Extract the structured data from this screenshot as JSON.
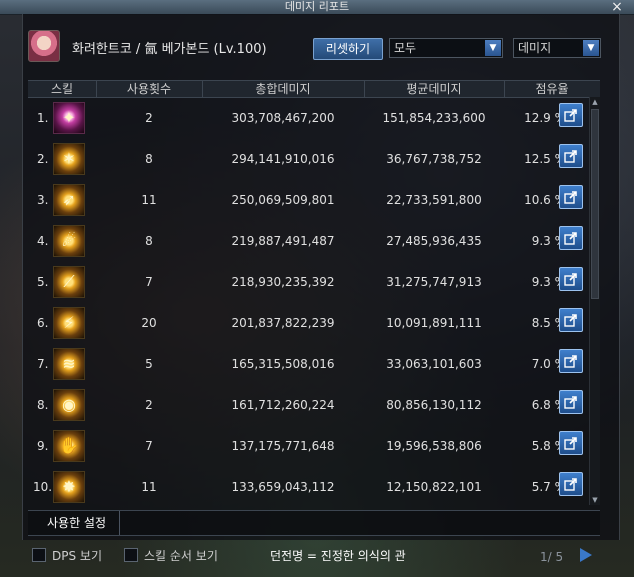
{
  "window": {
    "title": "데미지 리포트"
  },
  "header": {
    "character": "화려한트코 / 氤 베가본드 (Lv.100)",
    "reset_label": "리셋하기",
    "mode_select": "모두",
    "type_select": "데미지"
  },
  "table": {
    "columns": [
      "스킬",
      "사용횟수",
      "총합데미지",
      "평균데미지",
      "점유율"
    ],
    "rows": [
      {
        "rank": "1.",
        "count": "2",
        "total": "303,708,467,200",
        "avg": "151,854,233,600",
        "share": "12.9 %"
      },
      {
        "rank": "2.",
        "count": "8",
        "total": "294,141,910,016",
        "avg": "36,767,738,752",
        "share": "12.5 %"
      },
      {
        "rank": "3.",
        "count": "11",
        "total": "250,069,509,801",
        "avg": "22,733,591,800",
        "share": "10.6 %"
      },
      {
        "rank": "4.",
        "count": "8",
        "total": "219,887,491,487",
        "avg": "27,485,936,435",
        "share": "9.3 %"
      },
      {
        "rank": "5.",
        "count": "7",
        "total": "218,930,235,392",
        "avg": "31,275,747,913",
        "share": "9.3 %"
      },
      {
        "rank": "6.",
        "count": "20",
        "total": "201,837,822,239",
        "avg": "10,091,891,111",
        "share": "8.5 %"
      },
      {
        "rank": "7.",
        "count": "5",
        "total": "165,315,508,016",
        "avg": "33,063,101,603",
        "share": "7.0 %"
      },
      {
        "rank": "8.",
        "count": "2",
        "total": "161,712,260,224",
        "avg": "80,856,130,112",
        "share": "6.8 %"
      },
      {
        "rank": "9.",
        "count": "7",
        "total": "137,175,771,648",
        "avg": "19,596,538,806",
        "share": "5.8 %"
      },
      {
        "rank": "10.",
        "count": "11",
        "total": "133,659,043,112",
        "avg": "12,150,822,101",
        "share": "5.7 %"
      }
    ]
  },
  "bottom_tab": "사용한 설정",
  "footer": {
    "dps_label": "DPS 보기",
    "skill_order_label": "스킬 순서 보기",
    "dungeon": "던전명 = 진정한 의식의 관",
    "page": "1/ 5"
  },
  "colors": {
    "accent": "#3a78c8",
    "panel": "#0e1014"
  }
}
